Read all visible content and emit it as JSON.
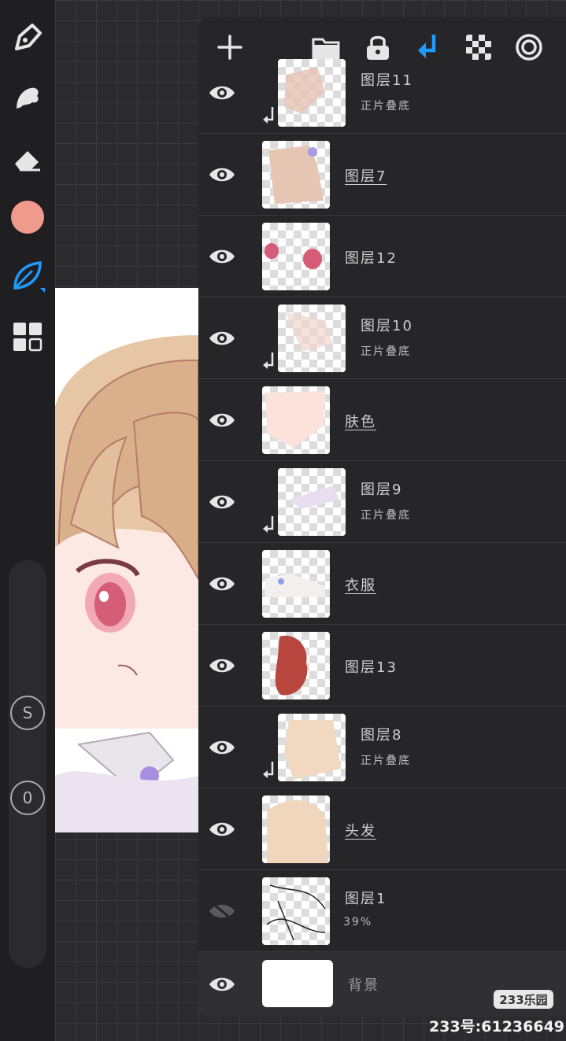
{
  "colors": {
    "accent": "#1e9bff",
    "current_color": "#f09a8e",
    "panel_bg": "#262628"
  },
  "toolbar": {
    "tools": [
      "pen-icon",
      "smudge-icon",
      "eraser-icon",
      "color-swatch",
      "leaf-brush-icon",
      "grid-icon"
    ],
    "slider_top_label": "S",
    "slider_bottom_label": "0"
  },
  "layers_panel": {
    "header_icons": [
      "add-icon",
      "folder-icon",
      "lock-icon",
      "clip-arrow-icon",
      "checker-icon",
      "target-icon"
    ],
    "layers": [
      {
        "name": "图层11",
        "sub": "正片叠底",
        "clipped": true,
        "visible": true,
        "underline": false
      },
      {
        "name": "图层7",
        "sub": "",
        "clipped": false,
        "visible": true,
        "underline": true
      },
      {
        "name": "图层12",
        "sub": "",
        "clipped": false,
        "visible": true,
        "underline": false
      },
      {
        "name": "图层10",
        "sub": "正片叠底",
        "clipped": true,
        "visible": true,
        "underline": false
      },
      {
        "name": "肤色",
        "sub": "",
        "clipped": false,
        "visible": true,
        "underline": true
      },
      {
        "name": "图层9",
        "sub": "正片叠底",
        "clipped": true,
        "visible": true,
        "underline": false
      },
      {
        "name": "衣服",
        "sub": "",
        "clipped": false,
        "visible": true,
        "underline": true
      },
      {
        "name": "图层13",
        "sub": "",
        "clipped": false,
        "visible": true,
        "underline": false
      },
      {
        "name": "图层8",
        "sub": "正片叠底",
        "clipped": true,
        "visible": true,
        "underline": false
      },
      {
        "name": "头发",
        "sub": "",
        "clipped": false,
        "visible": true,
        "underline": true
      },
      {
        "name": "图层1",
        "sub": "39%",
        "clipped": false,
        "visible": false,
        "underline": false
      }
    ],
    "background_layer": {
      "name": "背景",
      "visible": true
    }
  },
  "watermark": {
    "badge": "233乐园",
    "id": "233号:61236649"
  }
}
